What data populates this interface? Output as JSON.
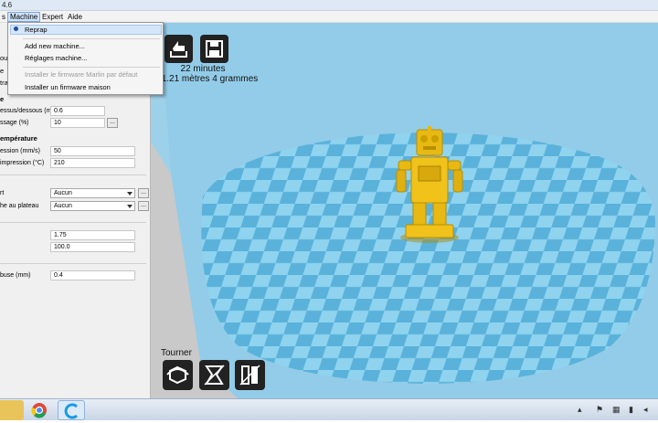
{
  "window": {
    "title": "4.6"
  },
  "menubar": {
    "items": [
      {
        "label": "s"
      },
      {
        "label": "Machine"
      },
      {
        "label": "Expert"
      },
      {
        "label": "Aide"
      }
    ]
  },
  "machine_menu": {
    "items": [
      {
        "label": "Reprap",
        "selected": true,
        "disabled": false
      },
      {
        "label": "Add new machine...",
        "disabled": false
      },
      {
        "label": "Réglages machine...",
        "disabled": false
      },
      {
        "label": "Installer le firmware Marlin par défaut",
        "disabled": true
      },
      {
        "label": "Installer un firmware maison",
        "disabled": false
      }
    ]
  },
  "settings": {
    "partial_labels": [
      "ou",
      "e",
      "tra"
    ],
    "quality_heading": "e",
    "top_bottom_label": "essus/dessous (mm)",
    "top_bottom_value": "0.6",
    "fill_label": "ssage (%)",
    "fill_value": "10",
    "temp_heading": "empérature",
    "speed_label": "ession (mm/s)",
    "speed_value": "50",
    "print_temp_label": "impression (°C)",
    "print_temp_value": "210",
    "support_label": "rt",
    "support_value": "Aucun",
    "adhesion_label": "he au plateau",
    "adhesion_value": "Aucun",
    "filament_label": "",
    "filament_diameter": "1.75",
    "flow_value": "100.0",
    "nozzle_label": "buse (mm)",
    "nozzle_value": "0.4",
    "ellipsis": "..."
  },
  "viewport": {
    "print_time": "22 minutes",
    "print_material": "1.21 mètres 4 grammes",
    "rotate_label": "Tourner",
    "colors": {
      "floor": "#93cce8",
      "plate_light": "#8fd3ef",
      "plate_dark": "#5ab2db",
      "model": "#e8b912"
    }
  },
  "taskbar": {
    "apps": [
      "folder-icon",
      "chrome-icon",
      "cura-icon"
    ]
  }
}
